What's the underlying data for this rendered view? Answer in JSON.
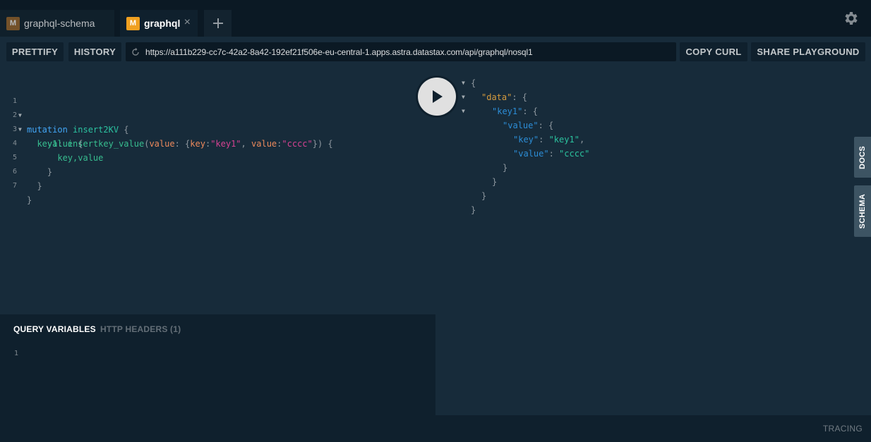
{
  "tabs": [
    {
      "badge": "M",
      "label": "graphql-schema",
      "active": false,
      "badge_color": "#a06a2c"
    },
    {
      "badge": "M",
      "label": "graphql",
      "active": true,
      "badge_color": "#f0a020"
    }
  ],
  "tab_close": "×",
  "tab_add": "+",
  "toolbar": {
    "prettify": "PRETTIFY",
    "history": "HISTORY",
    "endpoint": "https://a111b229-cc7c-42a2-8a42-192ef21f506e-eu-central-1.apps.astra.datastax.com/api/graphql/nosql1",
    "copy_curl": "COPY CURL",
    "share_playground": "SHARE PLAYGROUND"
  },
  "editor": {
    "line_numbers": [
      "1",
      "2",
      "3",
      "4",
      "5",
      "6",
      "7"
    ],
    "tokens": {
      "mutation": "mutation",
      "op_name": "insert2KV",
      "brace_open": "{",
      "alias": "key1",
      "colon": ":",
      "field": "insertkey_value",
      "paren_open": "(",
      "arg_value": "value",
      "brace_arg_open": "{",
      "arg_key": "key",
      "str_key1": "\"key1\"",
      "comma": ",",
      "arg_value2": "value",
      "str_cccc": "\"cccc\"",
      "args_close": "})",
      "sub_field": "value",
      "leaf_fields": "key,value",
      "brace_close": "}"
    }
  },
  "variables": {
    "query_variables_tab": "QUERY VARIABLES",
    "http_headers_tab": "HTTP HEADERS (1)",
    "line_number": "1"
  },
  "result": {
    "lines": [
      {
        "indent": 0,
        "fold": true,
        "parts": [
          {
            "t": "{",
            "c": "punc"
          }
        ]
      },
      {
        "indent": 1,
        "fold": true,
        "parts": [
          {
            "t": "\"data\"",
            "c": "rkey-data"
          },
          {
            "t": ": {",
            "c": "punc"
          }
        ]
      },
      {
        "indent": 2,
        "fold": true,
        "parts": [
          {
            "t": "\"key1\"",
            "c": "rkey"
          },
          {
            "t": ": {",
            "c": "punc"
          }
        ]
      },
      {
        "indent": 3,
        "fold": false,
        "parts": [
          {
            "t": "\"value\"",
            "c": "rkey"
          },
          {
            "t": ": {",
            "c": "punc"
          }
        ]
      },
      {
        "indent": 4,
        "fold": false,
        "parts": [
          {
            "t": "\"key\"",
            "c": "rkey"
          },
          {
            "t": ": ",
            "c": "punc"
          },
          {
            "t": "\"key1\"",
            "c": "rstr"
          },
          {
            "t": ",",
            "c": "punc"
          }
        ]
      },
      {
        "indent": 4,
        "fold": false,
        "parts": [
          {
            "t": "\"value\"",
            "c": "rkey"
          },
          {
            "t": ": ",
            "c": "punc"
          },
          {
            "t": "\"cccc\"",
            "c": "rstr"
          }
        ]
      },
      {
        "indent": 3,
        "fold": false,
        "parts": [
          {
            "t": "}",
            "c": "punc"
          }
        ]
      },
      {
        "indent": 2,
        "fold": false,
        "parts": [
          {
            "t": "}",
            "c": "punc"
          }
        ]
      },
      {
        "indent": 1,
        "fold": false,
        "parts": [
          {
            "t": "}",
            "c": "punc"
          }
        ]
      },
      {
        "indent": 0,
        "fold": false,
        "parts": [
          {
            "t": "}",
            "c": "punc"
          }
        ]
      }
    ]
  },
  "footer": {
    "tracing": "TRACING"
  },
  "side_tabs": {
    "docs": "DOCS",
    "schema": "SCHEMA"
  },
  "icons": {
    "settings": "gear-icon",
    "play": "play-icon",
    "reload": "reload-icon"
  }
}
